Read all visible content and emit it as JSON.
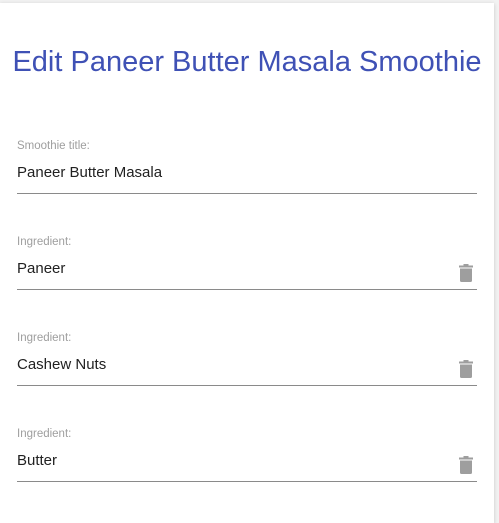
{
  "form": {
    "heading": "Edit Paneer Butter Masala Smoothie",
    "title_field": {
      "label": "Smoothie title:",
      "value": "Paneer Butter Masala"
    },
    "ingredients": [
      {
        "label": "Ingredient:",
        "value": "Paneer",
        "delete_icon": "trash-icon"
      },
      {
        "label": "Ingredient:",
        "value": "Cashew Nuts",
        "delete_icon": "trash-icon"
      },
      {
        "label": "Ingredient:",
        "value": "Butter",
        "delete_icon": "trash-icon"
      }
    ]
  },
  "colors": {
    "heading": "#3f51b5",
    "label": "#9e9e9e",
    "underline": "#8a8a8a",
    "icon": "#9e9e9e"
  }
}
